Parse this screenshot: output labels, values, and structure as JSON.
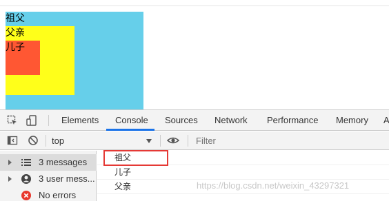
{
  "page": {
    "boxes": {
      "grandpa": "祖父",
      "father": "父亲",
      "son": "儿子"
    }
  },
  "devtools": {
    "tabs": [
      "Elements",
      "Console",
      "Sources",
      "Network",
      "Performance",
      "Memory",
      "A"
    ],
    "active_tab": "Console",
    "context": "top",
    "filter_placeholder": "Filter",
    "sidebar": [
      {
        "label": "3 messages",
        "icon": "list-icon"
      },
      {
        "label": "3 user mess...",
        "icon": "user-icon"
      },
      {
        "label": "No errors",
        "icon": "error-icon"
      }
    ],
    "messages": [
      "祖父",
      "儿子",
      "父亲"
    ]
  },
  "watermark": "https://blog.csdn.net/weixin_43297321",
  "colors": {
    "grandpa_bg": "#66cfea",
    "father_bg": "#ffff1a",
    "son_bg": "#ff5733",
    "active_tab_underline": "#1a73e8",
    "highlight_border": "#e53935"
  }
}
